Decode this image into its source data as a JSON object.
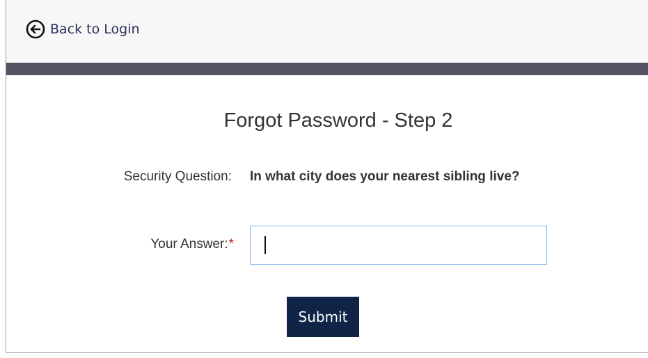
{
  "header": {
    "back_link_label": "Back to Login",
    "back_icon": "arrow-left-circle-icon"
  },
  "form": {
    "title": "Forgot Password - Step 2",
    "security_question_label": "Security Question:",
    "security_question": "In what city does your nearest sibling live?",
    "answer_label": "Your Answer:",
    "required_marker": "*",
    "answer_value": "",
    "submit_label": "Submit"
  },
  "colors": {
    "header_background": "#f7f7f7",
    "divider_bar": "#565163",
    "link_text": "#2b2f5c",
    "submit_background": "#0f2447",
    "input_border_focus": "#7fb4e6",
    "required_marker": "#c0272d"
  }
}
